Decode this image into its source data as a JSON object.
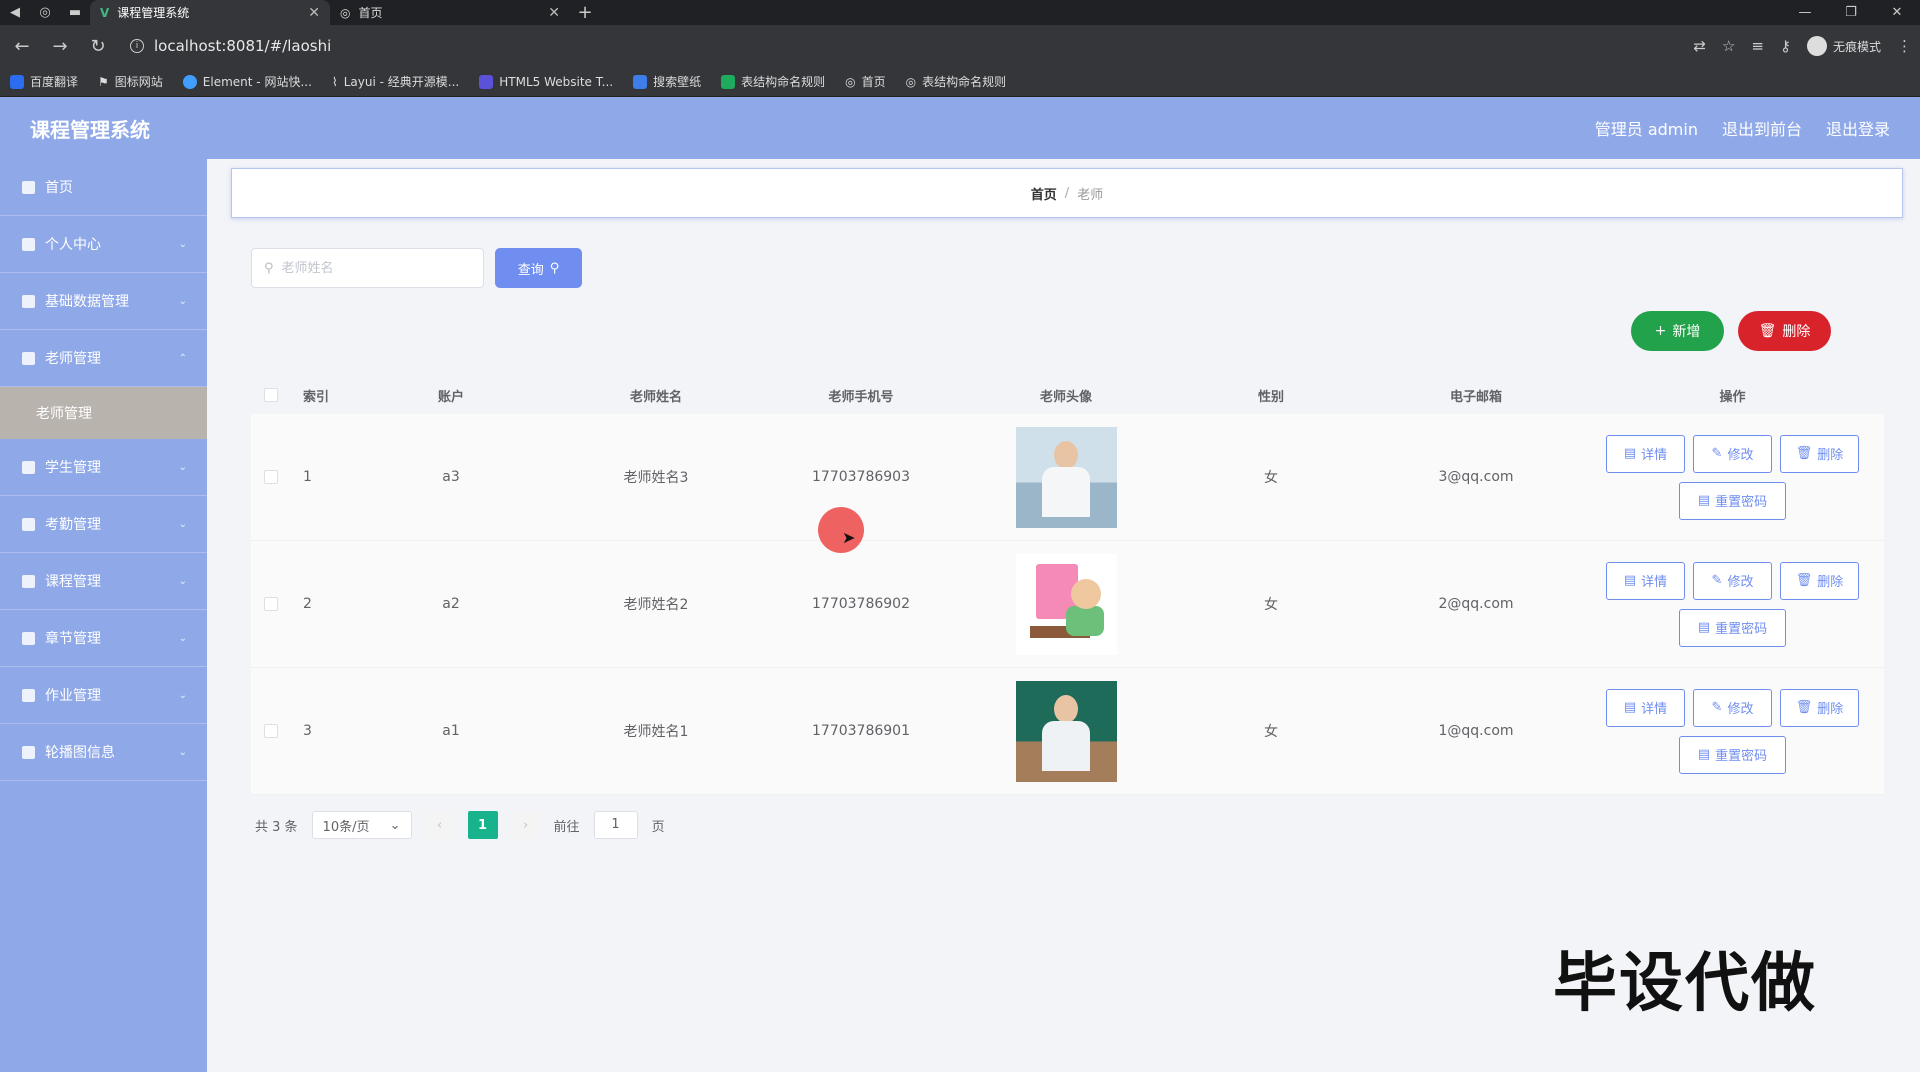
{
  "browser": {
    "tabs": [
      {
        "title": "课程管理系统",
        "active": true
      },
      {
        "title": "首页",
        "active": false
      }
    ],
    "url": "localhost:8081/#/laoshi",
    "incognito_label": "无痕模式",
    "bookmarks": [
      "百度翻译",
      "图标网站",
      "Element - 网站快...",
      "Layui - 经典开源模...",
      "HTML5 Website T...",
      "搜索壁纸",
      "表结构命名规则",
      "首页",
      "表结构命名规则"
    ]
  },
  "header": {
    "title": "课程管理系统",
    "links": [
      "管理员 admin",
      "退出到前台",
      "退出登录"
    ]
  },
  "sidebar": {
    "items": [
      {
        "label": "首页",
        "icon": "home-icon"
      },
      {
        "label": "个人中心",
        "icon": "user-icon"
      },
      {
        "label": "基础数据管理",
        "icon": "settings-icon"
      },
      {
        "label": "老师管理",
        "icon": "list-icon"
      },
      {
        "label": "学生管理",
        "icon": "student-icon"
      },
      {
        "label": "考勤管理",
        "icon": "menu-icon"
      },
      {
        "label": "课程管理",
        "icon": "course-icon"
      },
      {
        "label": "章节管理",
        "icon": "chapter-icon"
      },
      {
        "label": "作业管理",
        "icon": "chart-icon"
      },
      {
        "label": "轮播图信息",
        "icon": "image-icon"
      }
    ],
    "active_sub": "老师管理"
  },
  "breadcrumb": {
    "home": "首页",
    "sep": "/",
    "current": "老师"
  },
  "search": {
    "placeholder": "老师姓名",
    "button": "查询"
  },
  "actions": {
    "add": "新增",
    "delete": "删除"
  },
  "table": {
    "headers": [
      "索引",
      "账户",
      "老师姓名",
      "老师手机号",
      "老师头像",
      "性别",
      "电子邮箱",
      "操作"
    ],
    "rows": [
      {
        "index": "1",
        "account": "a3",
        "name": "老师姓名3",
        "phone": "17703786903",
        "sex": "女",
        "email": "3@qq.com"
      },
      {
        "index": "2",
        "account": "a2",
        "name": "老师姓名2",
        "phone": "17703786902",
        "sex": "女",
        "email": "2@qq.com"
      },
      {
        "index": "3",
        "account": "a1",
        "name": "老师姓名1",
        "phone": "17703786901",
        "sex": "女",
        "email": "1@qq.com"
      }
    ],
    "ops": {
      "detail": "详情",
      "edit": "修改",
      "delete": "删除",
      "reset": "重置密码"
    }
  },
  "pager": {
    "total": "共 3 条",
    "size": "10条/页",
    "page": "1",
    "goto_prefix": "前往",
    "goto_value": "1",
    "goto_suffix": "页"
  },
  "watermark": "毕设代做"
}
